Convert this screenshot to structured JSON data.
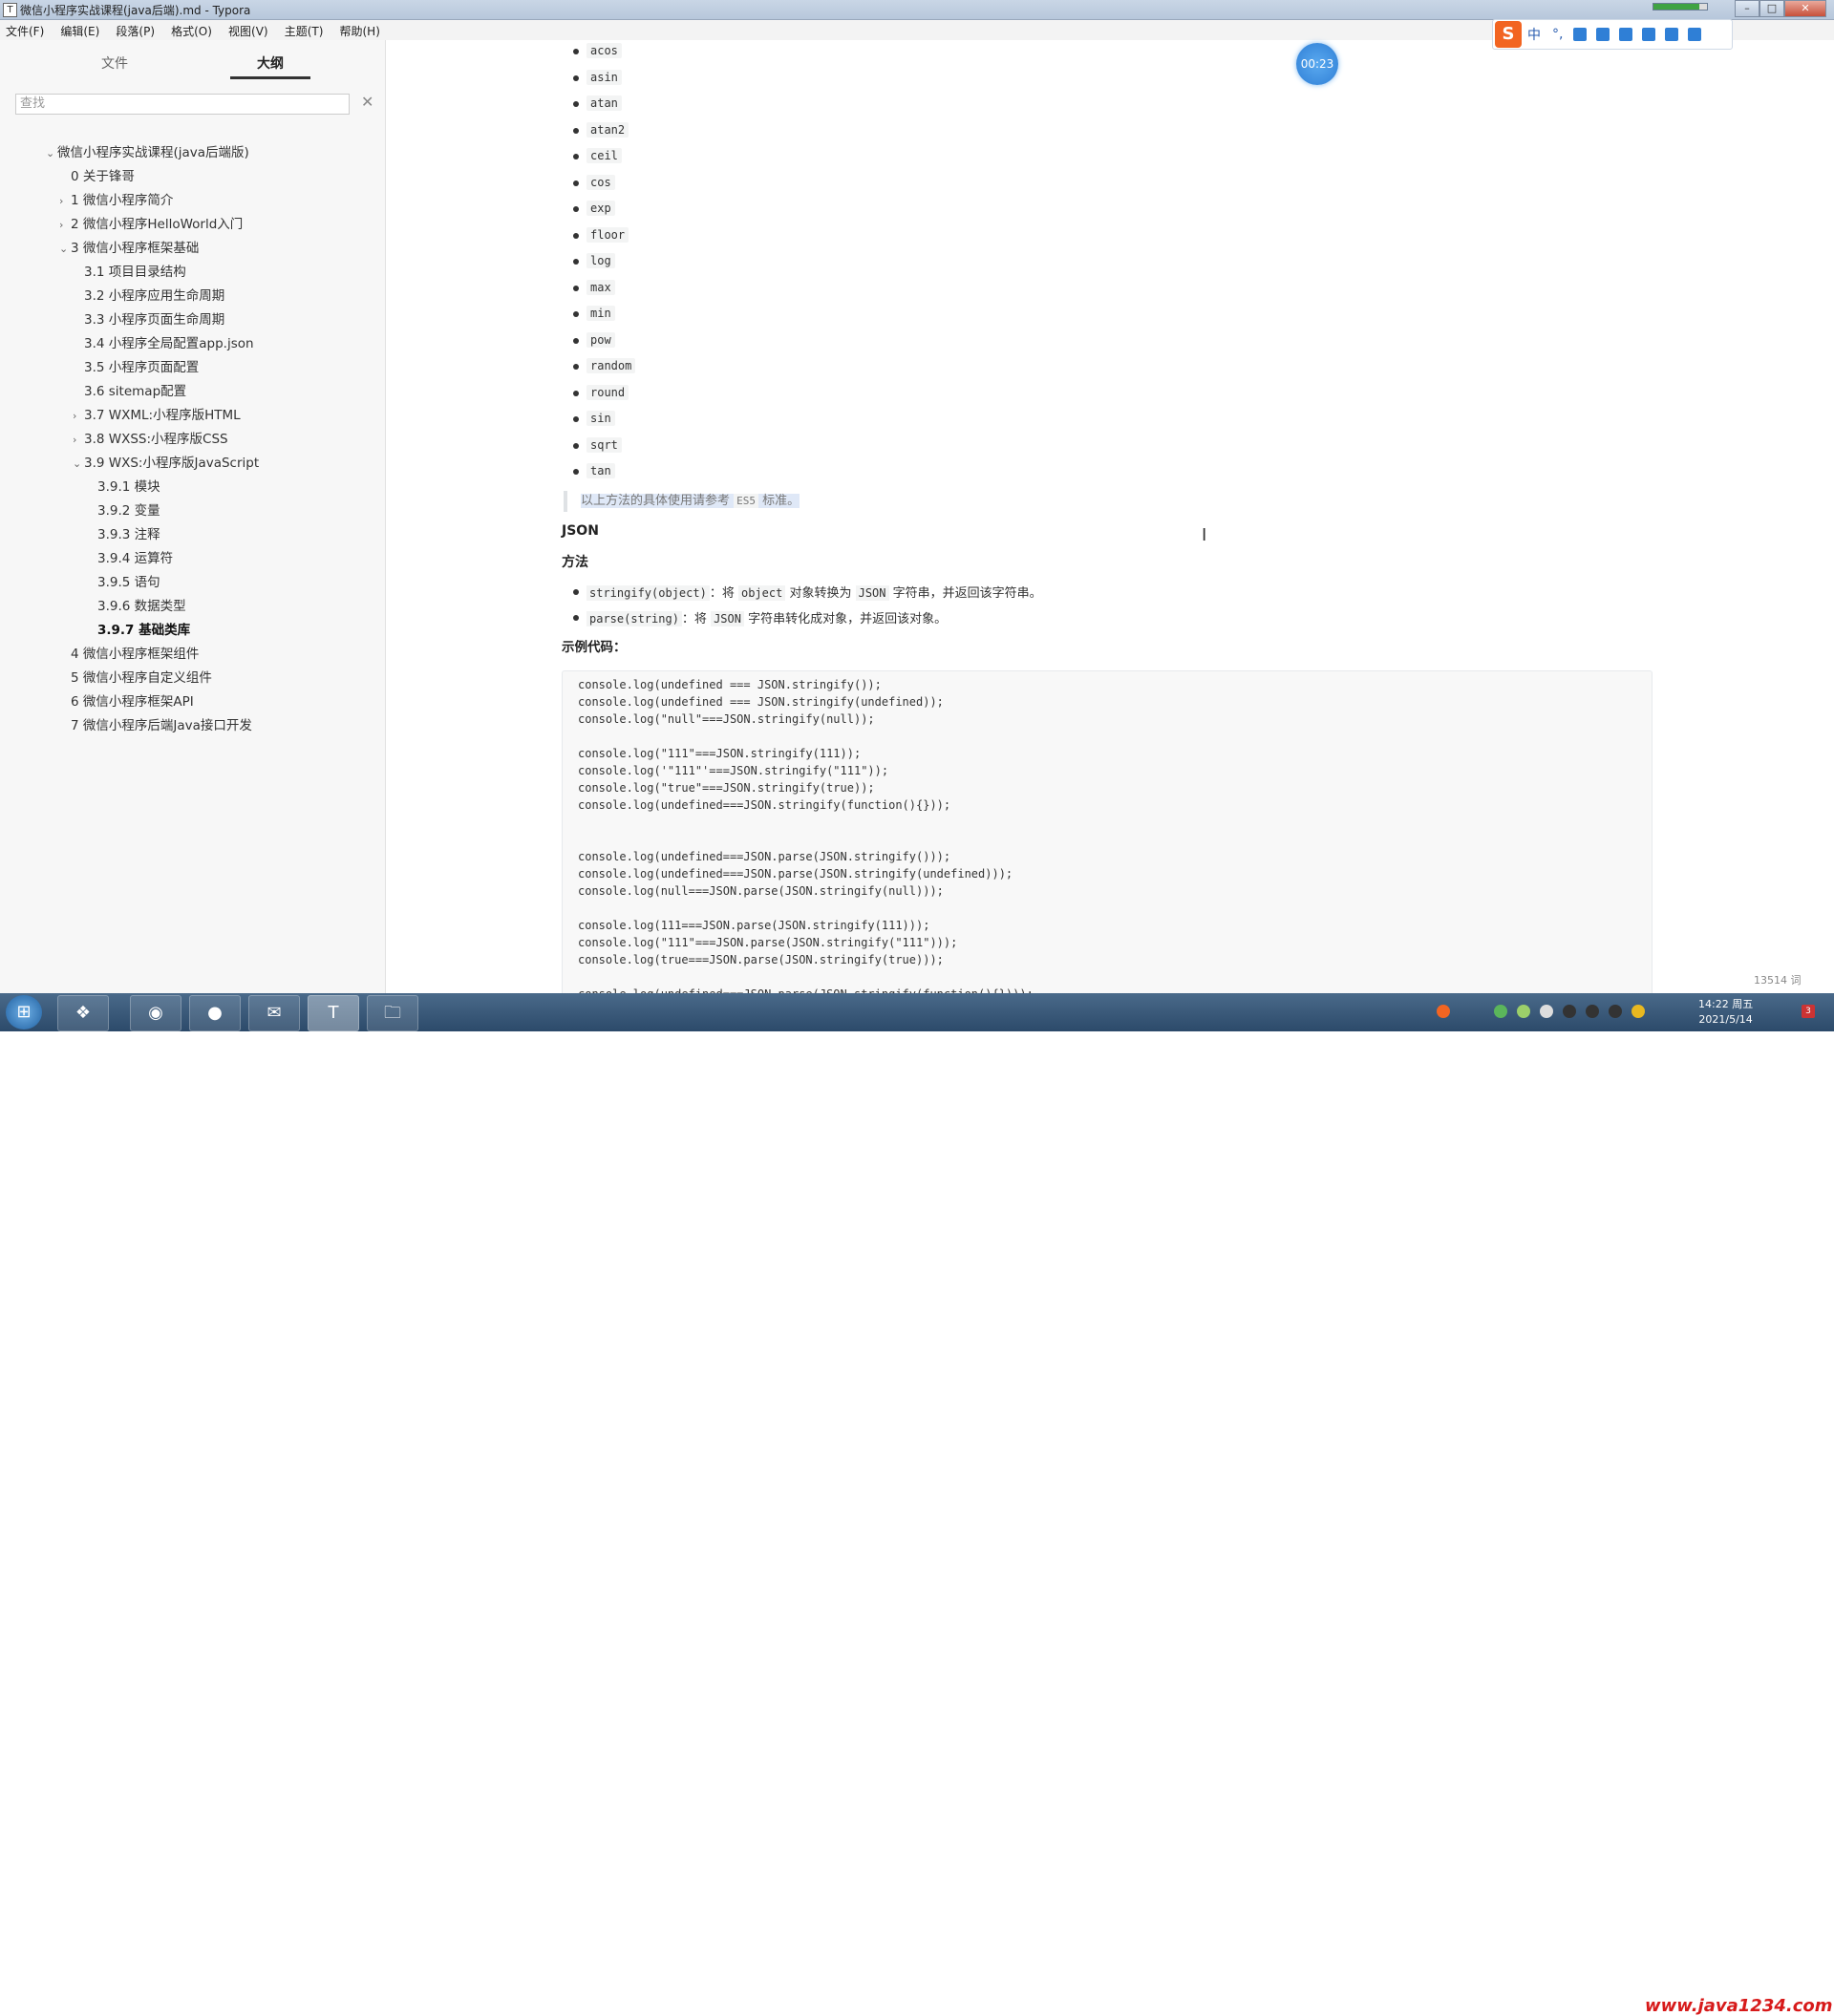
{
  "window": {
    "title": "微信小程序实战课程(java后端).md - Typora",
    "icon_label": "T",
    "btn_min": "–",
    "btn_max": "□",
    "btn_close": "✕"
  },
  "menu": [
    "文件(F)",
    "编辑(E)",
    "段落(P)",
    "格式(O)",
    "视图(V)",
    "主题(T)",
    "帮助(H)"
  ],
  "sidebar": {
    "tab_files": "文件",
    "tab_outline": "大纲",
    "search_placeholder": "查找",
    "search_clear": "✕",
    "outline": [
      {
        "arrow": "⌄",
        "label": "微信小程序实战课程(java后端版)"
      },
      {
        "arrow": "",
        "label": "0 关于锋哥"
      },
      {
        "arrow": "›",
        "label": "1 微信小程序简介"
      },
      {
        "arrow": "›",
        "label": "2 微信小程序HelloWorld入门"
      },
      {
        "arrow": "⌄",
        "label": "3 微信小程序框架基础"
      },
      {
        "arrow": "",
        "label": "3.1 项目目录结构"
      },
      {
        "arrow": "",
        "label": "3.2 小程序应用生命周期"
      },
      {
        "arrow": "",
        "label": "3.3 小程序页面生命周期"
      },
      {
        "arrow": "",
        "label": "3.4 小程序全局配置app.json"
      },
      {
        "arrow": "",
        "label": "3.5 小程序页面配置"
      },
      {
        "arrow": "",
        "label": "3.6 sitemap配置"
      },
      {
        "arrow": "›",
        "label": "3.7 WXML:小程序版HTML"
      },
      {
        "arrow": "›",
        "label": "3.8 WXSS:小程序版CSS"
      },
      {
        "arrow": "⌄",
        "label": "3.9 WXS:小程序版JavaScript"
      },
      {
        "arrow": "",
        "label": "3.9.1 模块"
      },
      {
        "arrow": "",
        "label": "3.9.2 变量"
      },
      {
        "arrow": "",
        "label": "3.9.3 注释"
      },
      {
        "arrow": "",
        "label": "3.9.4 运算符"
      },
      {
        "arrow": "",
        "label": "3.9.5 语句"
      },
      {
        "arrow": "",
        "label": "3.9.6 数据类型"
      },
      {
        "arrow": "",
        "label": "3.9.7 基础类库"
      },
      {
        "arrow": "",
        "label": "4 微信小程序框架组件"
      },
      {
        "arrow": "",
        "label": "5 微信小程序自定义组件"
      },
      {
        "arrow": "",
        "label": "6 微信小程序框架API"
      },
      {
        "arrow": "",
        "label": "7 微信小程序后端Java接口开发"
      }
    ]
  },
  "content": {
    "math_methods": [
      "acos",
      "asin",
      "atan",
      "atan2",
      "ceil",
      "cos",
      "exp",
      "floor",
      "log",
      "max",
      "min",
      "pow",
      "random",
      "round",
      "sin",
      "sqrt",
      "tan"
    ],
    "quote_pre": "以上方法的具体使用请参考 ",
    "quote_code": "ES5",
    "quote_post": " 标准。",
    "json_heading": "JSON",
    "method_heading": "方法",
    "json_methods": [
      {
        "code": "stringify(object)",
        "mid": "：将 ",
        "code2": "object",
        "mid2": " 对象转换为 ",
        "code3": "JSON",
        "tail": " 字符串，并返回该字符串。"
      },
      {
        "code": "parse(string)",
        "mid": "：将 ",
        "code2": "JSON",
        "mid2": " 字符串转化成对象，并返回该对象。",
        "code3": "",
        "tail": ""
      }
    ],
    "example_heading": "示例代码：",
    "code_lines": [
      "console.log(undefined === JSON.stringify());",
      "console.log(undefined === JSON.stringify(undefined));",
      "console.log(\"null\"===JSON.stringify(null));",
      "",
      "console.log(\"111\"===JSON.stringify(111));",
      "console.log('\"111\"'===JSON.stringify(\"111\"));",
      "console.log(\"true\"===JSON.stringify(true));",
      "console.log(undefined===JSON.stringify(function(){}));",
      "",
      "",
      "console.log(undefined===JSON.parse(JSON.stringify()));",
      "console.log(undefined===JSON.parse(JSON.stringify(undefined)));",
      "console.log(null===JSON.parse(JSON.stringify(null)));",
      "",
      "console.log(111===JSON.parse(JSON.stringify(111)));",
      "console.log(\"111\"===JSON.parse(JSON.stringify(\"111\")));",
      "console.log(true===JSON.parse(JSON.stringify(true)));",
      "",
      "console.log(undefined===JSON.parse(JSON.stringify(function(){})));"
    ]
  },
  "timer": "00:23",
  "ime": {
    "logo": "S",
    "mode": "中",
    "punct": "°,"
  },
  "bottom": {
    "prev": "‹",
    "source": "</>",
    "word_count": "13514 词"
  },
  "taskbar": {
    "start": "⊞",
    "apps": [
      "❖",
      "◉",
      "●",
      "✉",
      "T",
      "🗀"
    ]
  },
  "clock": {
    "time": "14:22 周五",
    "date": "2021/5/14"
  },
  "watermark": "www.java1234.com",
  "tray_badge": "3",
  "colors": {
    "accent": "#2f7fd6",
    "sidebar_bg": "#f7f7f7",
    "code_bg": "#f8f8f8",
    "ime_orange": "#f26522",
    "watermark_red": "#d71a1a"
  },
  "status": {
    "level_bar_fraction": 0.85
  }
}
